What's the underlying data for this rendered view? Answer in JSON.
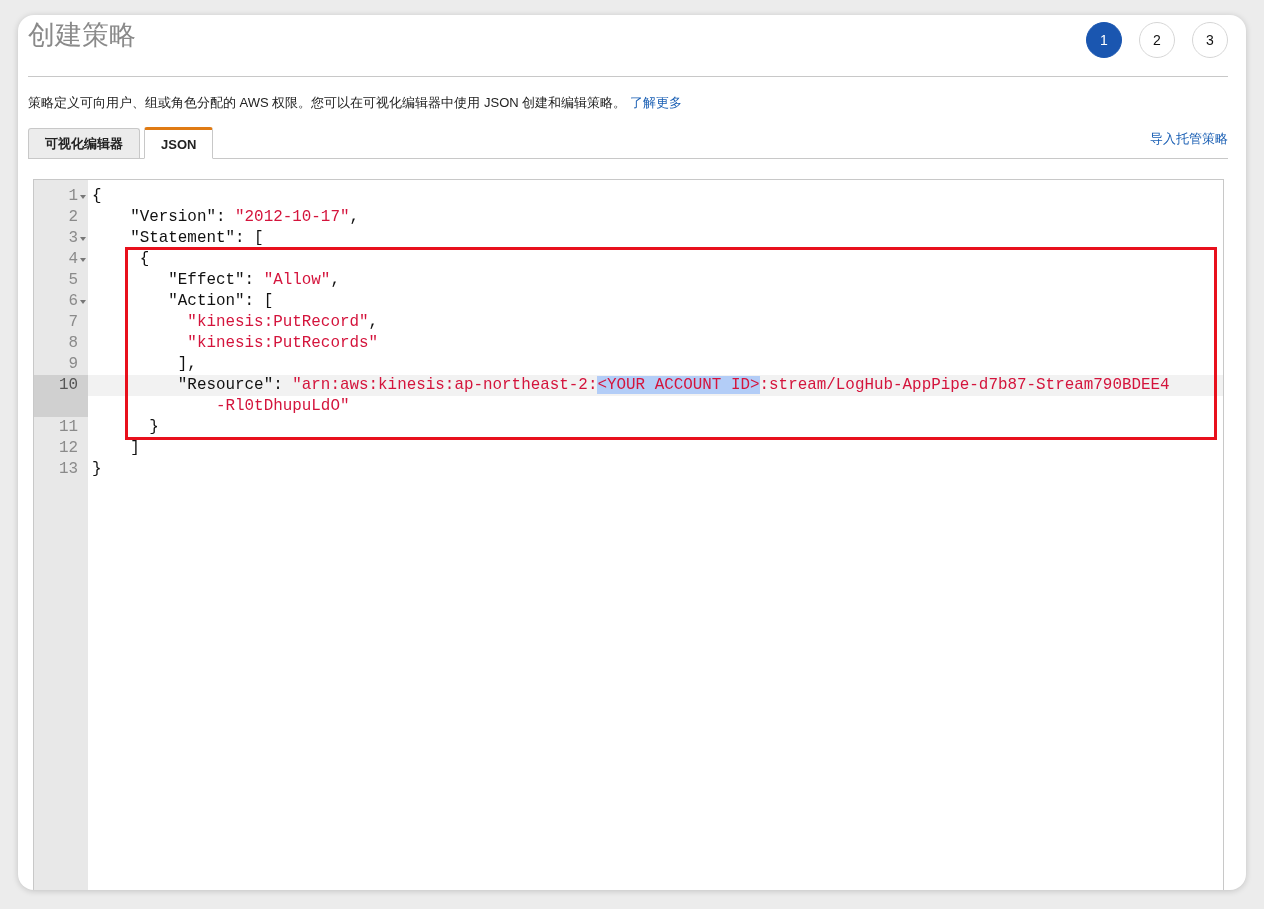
{
  "title": "创建策略",
  "steps": [
    {
      "label": "1",
      "selected": true
    },
    {
      "label": "2",
      "selected": false
    },
    {
      "label": "3",
      "selected": false
    }
  ],
  "description": "策略定义可向用户、组或角色分配的 AWS 权限。您可以在可视化编辑器中使用 JSON 创建和编辑策略。",
  "learn_more": "了解更多",
  "tabs": [
    {
      "label": "可视化编辑器",
      "selected": false
    },
    {
      "label": "JSON",
      "selected": true
    }
  ],
  "import_link": "导入托管策略",
  "editor": {
    "lines": [
      {
        "number": "1",
        "foldable": true,
        "active": false,
        "boxed": false,
        "tokens": [
          {
            "kind": "plain",
            "text": "{"
          }
        ]
      },
      {
        "number": "2",
        "foldable": false,
        "active": false,
        "boxed": false,
        "tokens": [
          {
            "kind": "key",
            "text": "    \"Version\""
          },
          {
            "kind": "plain",
            "text": ": "
          },
          {
            "kind": "string",
            "text": "\"2012-10-17\""
          },
          {
            "kind": "plain",
            "text": ","
          }
        ]
      },
      {
        "number": "3",
        "foldable": true,
        "active": false,
        "boxed": false,
        "tokens": [
          {
            "kind": "key",
            "text": "    \"Statement\""
          },
          {
            "kind": "plain",
            "text": ": ["
          }
        ]
      },
      {
        "number": "4",
        "foldable": true,
        "active": false,
        "boxed": true,
        "tokens": [
          {
            "kind": "plain",
            "text": "     {"
          }
        ]
      },
      {
        "number": "5",
        "foldable": false,
        "active": false,
        "boxed": true,
        "tokens": [
          {
            "kind": "key",
            "text": "        \"Effect\""
          },
          {
            "kind": "plain",
            "text": ": "
          },
          {
            "kind": "string",
            "text": "\"Allow\""
          },
          {
            "kind": "plain",
            "text": ","
          }
        ]
      },
      {
        "number": "6",
        "foldable": true,
        "active": false,
        "boxed": true,
        "tokens": [
          {
            "kind": "key",
            "text": "        \"Action\""
          },
          {
            "kind": "plain",
            "text": ": ["
          }
        ]
      },
      {
        "number": "7",
        "foldable": false,
        "active": false,
        "boxed": true,
        "tokens": [
          {
            "kind": "string",
            "text": "          \"kinesis:PutRecord\""
          },
          {
            "kind": "plain",
            "text": ","
          }
        ]
      },
      {
        "number": "8",
        "foldable": false,
        "active": false,
        "boxed": true,
        "tokens": [
          {
            "kind": "string",
            "text": "          \"kinesis:PutRecords\""
          }
        ]
      },
      {
        "number": "9",
        "foldable": false,
        "active": false,
        "boxed": true,
        "tokens": [
          {
            "kind": "plain",
            "text": "         ],"
          }
        ]
      },
      {
        "number": "10",
        "foldable": false,
        "active": true,
        "boxed": true,
        "tokens": [
          {
            "kind": "key",
            "text": "         \"Resource\""
          },
          {
            "kind": "plain",
            "text": ": "
          },
          {
            "kind": "string",
            "text": "\"arn:aws:kinesis:ap-northeast-2:"
          },
          {
            "kind": "selected",
            "text": "<YOUR ACCOUNT ID>"
          },
          {
            "kind": "string",
            "text": ":stream/LogHub-AppPipe-d7b87-Stream790BDEE4"
          }
        ],
        "continuation": [
          {
            "kind": "string",
            "text": "             -Rl0tDhupuLdO\""
          }
        ]
      },
      {
        "number": "11",
        "foldable": false,
        "active": false,
        "boxed": true,
        "tokens": [
          {
            "kind": "plain",
            "text": "      }"
          }
        ]
      },
      {
        "number": "12",
        "foldable": false,
        "active": false,
        "boxed": false,
        "tokens": [
          {
            "kind": "plain",
            "text": "    ]"
          }
        ]
      },
      {
        "number": "13",
        "foldable": false,
        "active": false,
        "boxed": false,
        "tokens": [
          {
            "kind": "plain",
            "text": "}"
          }
        ]
      }
    ]
  }
}
